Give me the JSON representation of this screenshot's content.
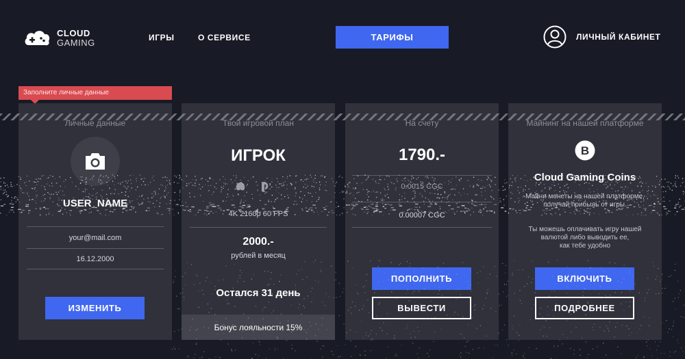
{
  "header": {
    "logo_line1": "CLOUD",
    "logo_line2": "GAMING",
    "nav_games": "ИГРЫ",
    "nav_about": "О СЕРВИСЕ",
    "nav_tariffs": "ТАРИФЫ",
    "account_label": "ЛИЧНЫЙ КАБИНЕТ"
  },
  "hint": "Заполните личные данные",
  "profile": {
    "title": "Личные данные",
    "username": "USER_NAME",
    "email": "your@mail.com",
    "date": "16.12.2000",
    "edit_button": "ИЗМЕНИТЬ"
  },
  "plan": {
    "title": "Твой игровой план",
    "name": "ИГРОК",
    "quality": "4K 2160p 60 FPS",
    "price": "2000.-",
    "price_unit": "рублей в месяц",
    "remaining": "Остался 31 день",
    "bonus": "Бонус лояльности 15%"
  },
  "account": {
    "title": "На счету",
    "balance": "1790.-",
    "balance_sub": "0.0015 CGC",
    "coins": "0.00007 CGC",
    "topup_button": "ПОПОЛНИТЬ",
    "withdraw_button": "ВЫВЕСТИ"
  },
  "mining": {
    "title": "Майнинг на нашей платформе",
    "coin_name": "Cloud Gaming Coins",
    "text1_line1": "Майни монеты на нашей платформе,",
    "text1_line2": "получай прибыль от игры.",
    "text2_line1": "Ты можешь оплачивать игру нашей",
    "text2_line2": "валютой либо выводить ее,",
    "text2_line3": "как тебе удобно",
    "enable_button": "ВКЛЮЧИТЬ",
    "more_button": "ПОДРОБНЕЕ"
  },
  "colors": {
    "background": "#181a25",
    "card": "#30313b",
    "accent": "#3f67f0",
    "alert": "#d94b51"
  }
}
